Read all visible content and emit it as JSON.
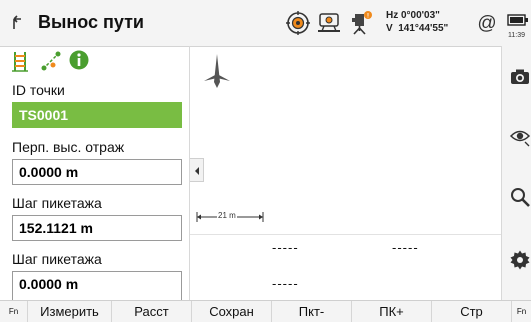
{
  "header": {
    "title": "Вынос пути",
    "hz_line": "Hz 0°00'03\"",
    "v_line": "V  141°44'55\"",
    "time": "11:39",
    "icons": [
      "back-arrow-icon",
      "target-icon",
      "station-setup-icon",
      "instrument-alert-icon",
      "at-sign-icon",
      "battery-icon"
    ]
  },
  "left_panel": {
    "mode_icons": [
      "chainage-ladder-icon",
      "line-offset-icon",
      "info-icon"
    ],
    "point_id_label": "ID точки",
    "point_id_value": "TS0001",
    "reflector_label": "Перп. выс. отраж",
    "reflector_value": "0.0000 m",
    "chainage_label": "Шаг пикетажа",
    "chainage_value": "152.1121 m",
    "chainage2_label": "Шаг пикетажа",
    "chainage2_value": "0.0000 m"
  },
  "map": {
    "scale_label": "21 m",
    "readouts": [
      "-----",
      "-----",
      "-----"
    ],
    "icons": [
      "north-arrow-icon",
      "collapse-left-icon"
    ]
  },
  "right_toolbar": {
    "buttons": [
      "camera-icon",
      "eye-icon",
      "search-icon",
      "settings-gear-icon"
    ]
  },
  "softkeys": {
    "fn_left": "Fn",
    "measure": "Измерить",
    "distance": "Расст",
    "save": "Сохран",
    "point_minus": "Пкт-",
    "chainage_plus": "ПК+",
    "page": "Стр",
    "fn_right": "Fn"
  },
  "colors": {
    "selected_field": "#79bd43",
    "accent_green": "#4a9e2f",
    "alert_orange": "#f08a1c"
  }
}
